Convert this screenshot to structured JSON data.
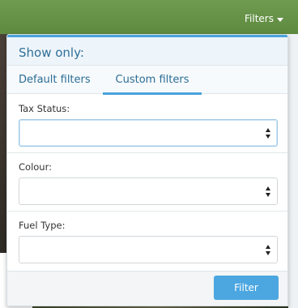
{
  "header": {
    "filters_toggle_label": "Filters",
    "toggle_icon": "caret-down-icon"
  },
  "panel": {
    "title": "Show only:",
    "tabs": [
      {
        "label": "Default filters",
        "active": false
      },
      {
        "label": "Custom filters",
        "active": true
      }
    ],
    "fields": [
      {
        "label": "Tax Status:",
        "value": "",
        "icon": "select-arrows-icon"
      },
      {
        "label": "Colour:",
        "value": "",
        "icon": "select-arrows-icon"
      },
      {
        "label": "Fuel Type:",
        "value": "",
        "icon": "select-arrows-icon"
      }
    ],
    "submit_label": "Filter"
  },
  "colors": {
    "header_bar": "#6f9b50",
    "accent": "#49a3dc",
    "button": "#4ca6e0",
    "link": "#2b6c95"
  }
}
